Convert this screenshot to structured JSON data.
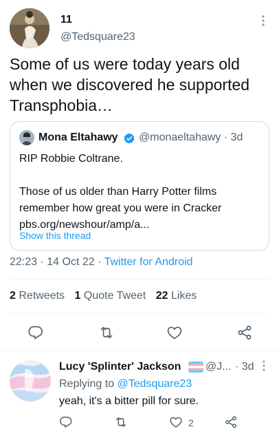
{
  "tweet": {
    "author_name": "11",
    "author_handle": "@Tedsquare23",
    "text": "Some of us were today years old when we discovered he supported Transphobia…",
    "meta": {
      "time": "22:23",
      "date": "14 Oct 22",
      "separator": "·",
      "source": "Twitter for Android"
    },
    "stats": {
      "retweets_count": "2",
      "retweets_label": "Retweets",
      "quotes_count": "1",
      "quotes_label": "Quote Tweet",
      "likes_count": "22",
      "likes_label": "Likes"
    }
  },
  "quote": {
    "author_name": "Mona Eltahawy",
    "author_handle": "@monaeltahawy",
    "age": "3d",
    "text": "RIP Robbie Coltrane.\n\nThose of us older than Harry Potter films remember how great you were in Cracker\npbs.org/newshour/amp/a...",
    "show_thread": "Show this thread"
  },
  "reply": {
    "author_name": "Lucy 'Splinter' Jackson",
    "author_handle": "@J...",
    "age": "· 3d",
    "replying_prefix": "Replying to",
    "replying_handle": "@Tedsquare23",
    "text": "yeah, it's a bitter pill for sure.",
    "like_count": "2"
  },
  "icons": {
    "reply": "reply-icon",
    "retweet": "retweet-icon",
    "like": "heart-icon",
    "share": "share-icon",
    "more": "more-icon",
    "verified": "verified-badge-icon",
    "flag": "transgender-flag-icon"
  },
  "colors": {
    "accent": "#1d9bf0",
    "text": "#0f1419",
    "secondary": "#536471",
    "border": "#cfd9de",
    "divider": "#eff3f4"
  }
}
